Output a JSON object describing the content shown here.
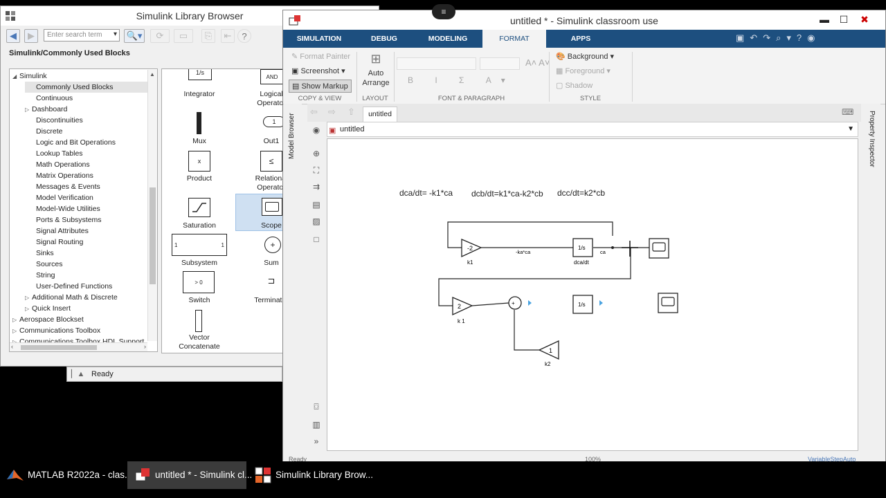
{
  "library_browser": {
    "title": "Simulink Library Browser",
    "search_placeholder": "Enter search term",
    "breadcrumb": "Simulink/Commonly Used Blocks",
    "status": "Ready",
    "tree": [
      {
        "label": "Simulink",
        "expanded": true,
        "indent": 0
      },
      {
        "label": "Commonly Used Blocks",
        "indent": 1,
        "selected": true
      },
      {
        "label": "Continuous",
        "indent": 1
      },
      {
        "label": "Dashboard",
        "indent": 1,
        "has_children": true
      },
      {
        "label": "Discontinuities",
        "indent": 1
      },
      {
        "label": "Discrete",
        "indent": 1
      },
      {
        "label": "Logic and Bit Operations",
        "indent": 1
      },
      {
        "label": "Lookup Tables",
        "indent": 1
      },
      {
        "label": "Math Operations",
        "indent": 1
      },
      {
        "label": "Matrix Operations",
        "indent": 1
      },
      {
        "label": "Messages & Events",
        "indent": 1
      },
      {
        "label": "Model Verification",
        "indent": 1
      },
      {
        "label": "Model-Wide Utilities",
        "indent": 1
      },
      {
        "label": "Ports & Subsystems",
        "indent": 1
      },
      {
        "label": "Signal Attributes",
        "indent": 1
      },
      {
        "label": "Signal Routing",
        "indent": 1
      },
      {
        "label": "Sinks",
        "indent": 1
      },
      {
        "label": "Sources",
        "indent": 1
      },
      {
        "label": "String",
        "indent": 1
      },
      {
        "label": "User-Defined Functions",
        "indent": 1
      },
      {
        "label": "Additional Math & Discrete",
        "indent": 1,
        "has_children": true
      },
      {
        "label": "Quick Insert",
        "indent": 1,
        "has_children": true
      },
      {
        "label": "Aerospace Blockset",
        "indent": 0,
        "has_children": true
      },
      {
        "label": "Communications Toolbox",
        "indent": 0,
        "has_children": true
      },
      {
        "label": "Communications Toolbox HDL Support",
        "indent": 0,
        "has_children": true
      }
    ],
    "blocks": {
      "integrator": "Integrator",
      "logical": "Logical\nOperator",
      "mux": "Mux",
      "out1": "Out1",
      "product": "Product",
      "relational": "Relational\nOperator",
      "saturation": "Saturation",
      "scope": "Scope",
      "subsystem": "Subsystem",
      "sum": "Sum",
      "switch": "Switch",
      "terminator": "Terminator",
      "vector_concat": "Vector\nConcatenate",
      "and_glyph": "AND",
      "out1_glyph": "1",
      "product_glyph": "x",
      "relational_glyph": "≤",
      "integrator_glyph": "1/s",
      "switch_glyph": "> 0",
      "subsystem_in": "1",
      "subsystem_out": "1"
    }
  },
  "model_window": {
    "title": "untitled * - Simulink classroom use",
    "tabs": [
      "SIMULATION",
      "DEBUG",
      "MODELING",
      "FORMAT",
      "APPS"
    ],
    "active_tab": "FORMAT",
    "strip": {
      "format_painter": "Format Painter",
      "screenshot": "Screenshot",
      "show_markup": "Show Markup",
      "auto_arrange": "Auto\nArrange",
      "background": "Background",
      "foreground": "Foreground",
      "shadow": "Shadow",
      "sections": [
        "COPY & VIEW",
        "LAYOUT",
        "FONT & PARAGRAPH",
        "STYLE"
      ]
    },
    "model_tab": "untitled",
    "address": "untitled",
    "left_panel": "Model Browser",
    "right_panel": "Property Inspector",
    "status_left": "Ready",
    "status_mid": "100%",
    "status_right": "VariableStepAuto",
    "annotations": [
      "dca/dt= -k1*ca",
      "dcb/dt=k1*ca-k2*cb",
      "dcc/dt=k2*cb"
    ],
    "diagram": {
      "gain1_value": "-2",
      "gain1_label": "k1",
      "int1_glyph": "1/s",
      "int1_label": "dca/dt",
      "signal1_label": "-ka*ca",
      "signal2_label": "ca",
      "gain2_value": "2",
      "gain2_label": "k 1",
      "int2_glyph": "1/s",
      "gain3_value": "1",
      "gain3_label": "k2"
    }
  },
  "taskbar": {
    "items": [
      {
        "label": "MATLAB R2022a - clas...",
        "active": false
      },
      {
        "label": "untitled * - Simulink cl...",
        "active": true
      },
      {
        "label": "Simulink Library Brow...",
        "active": false
      }
    ]
  }
}
